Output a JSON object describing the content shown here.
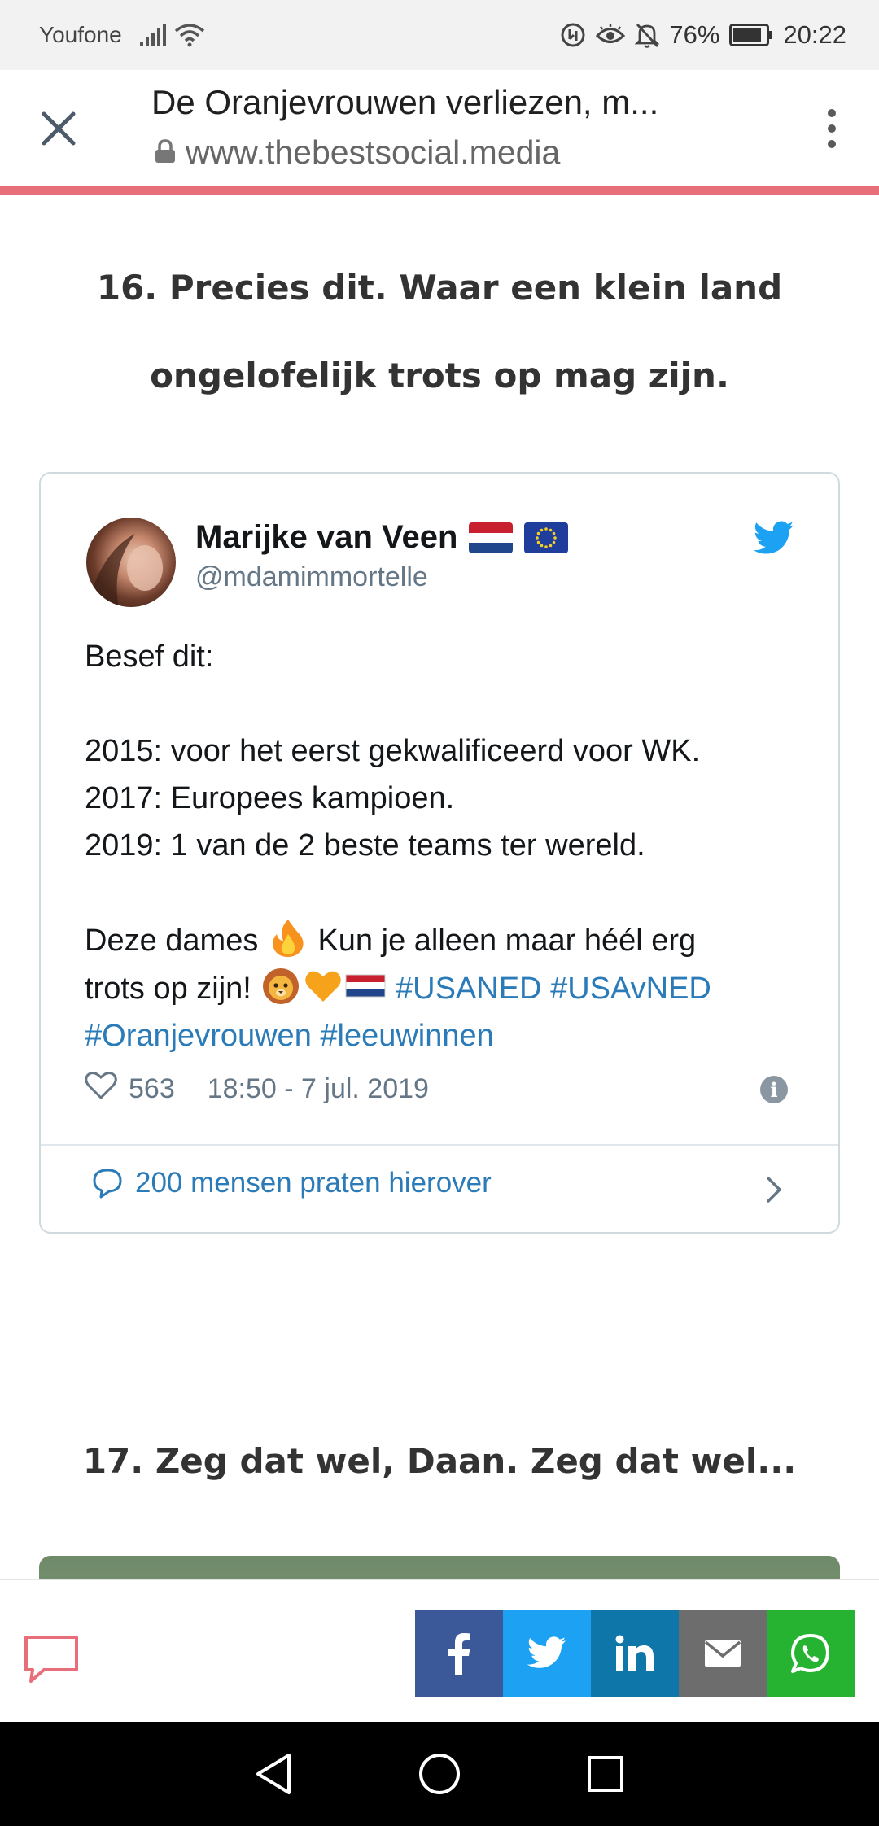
{
  "status_bar": {
    "carrier": "Youfone",
    "battery": "76%",
    "time": "20:22"
  },
  "browser": {
    "page_title": "De Oranjevrouwen verliezen, m...",
    "url": "www.thebestsocial.media",
    "progress_fraction": 1.0
  },
  "article": {
    "heading_16_line1": "16. Precies dit. Waar een klein land",
    "heading_16_line2": "ongelofelijk trots op mag zijn.",
    "heading_17": "17. Zeg dat wel, Daan. Zeg dat wel..."
  },
  "tweet": {
    "author_name": "Marijke van Veen",
    "handle": "@mdamimmortelle",
    "line1": "Besef dit:",
    "line2": "2015: voor het eerst gekwalificeerd voor WK.",
    "line3": "2017: Europees kampioen.",
    "line4": "2019: 1 van de 2 beste teams ter wereld.",
    "line5_a": "Deze dames",
    "line5_b": "Kun je alleen maar héél erg",
    "line6_a": "trots op zijn!",
    "hashtag1": "#USANED",
    "hashtag2": "#USAvNED",
    "hashtag3": "#Oranjevrouwen",
    "hashtag4": "#leeuwinnen",
    "likes": "563",
    "timestamp": "18:50 - 7 jul. 2019",
    "footer": "200 mensen praten hierover"
  },
  "colors": {
    "accent_progress": "#e86f7a",
    "link": "#2b7bb9",
    "facebook": "#3b5998",
    "twitter": "#1da1f2",
    "linkedin": "#0e76a8",
    "email": "#6d6d6d",
    "whatsapp": "#25b331"
  },
  "icons": [
    "signal-icon",
    "wifi-icon",
    "data-saver-icon",
    "eye-comfort-icon",
    "bell-off-icon",
    "battery-icon",
    "close-icon",
    "lock-icon",
    "more-vert-icon",
    "twitter-bird-icon",
    "heart-icon",
    "info-icon",
    "speech-bubble-icon",
    "chevron-right-icon",
    "comment-icon",
    "facebook-icon",
    "twitter-icon",
    "linkedin-icon",
    "email-icon",
    "whatsapp-icon",
    "back-icon",
    "home-icon",
    "recents-icon"
  ]
}
